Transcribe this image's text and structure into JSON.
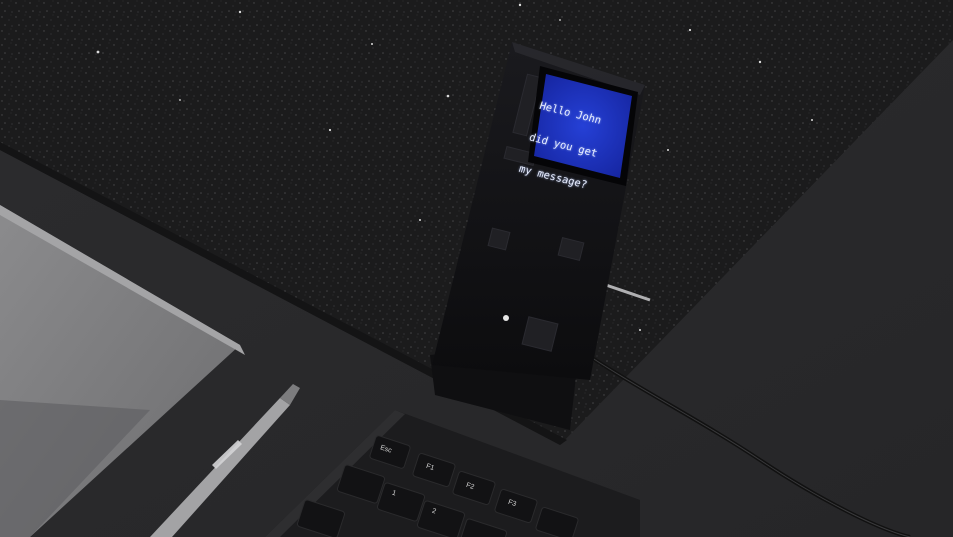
{
  "scene": {
    "description_hidden": ""
  },
  "device": {
    "screen_lines": [
      "Hello John",
      "did you get",
      "my message?"
    ]
  },
  "keyboard": {
    "keys": [
      "Esc",
      "F1",
      "F2",
      "F3",
      "1",
      "2"
    ]
  },
  "colors": {
    "desk": "#2b2b2d",
    "mat": "#1a1a1a",
    "device_body": "#101012",
    "screen_bg": "#1b2fb8",
    "screen_text": "#e8eeff"
  }
}
